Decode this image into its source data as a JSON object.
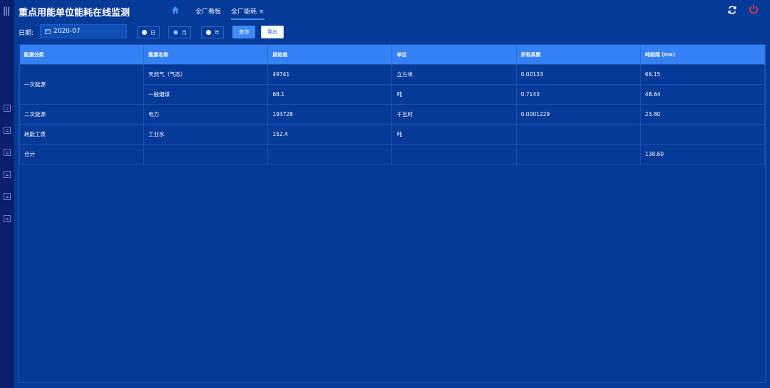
{
  "header": {
    "title": "重点用能单位能耗在线监测",
    "tabs": [
      {
        "label": "全厂看板"
      },
      {
        "label": "全厂能耗",
        "close": "×"
      }
    ]
  },
  "toolbar": {
    "date_label": "日期:",
    "date_value": "2020-07",
    "radios": [
      "日",
      "月",
      "年"
    ],
    "selected_radio": "月",
    "query_label": "查询",
    "export_label": "导出"
  },
  "table": {
    "columns": [
      "能源分类",
      "能源名称",
      "原始值",
      "单位",
      "折标系数",
      "吨标煤 (tce)"
    ],
    "rows": [
      {
        "category": "一次能源",
        "name": "天然气（气态）",
        "raw": "49741",
        "unit": "立方米",
        "factor": "0.00133",
        "tce": "66.15"
      },
      {
        "category": "",
        "name": "一般烟煤",
        "raw": "68.1",
        "unit": "吨",
        "factor": "0.7143",
        "tce": "48.64"
      },
      {
        "category": "二次能源",
        "name": "电力",
        "raw": "193728",
        "unit": "千瓦时",
        "factor": "0.0001229",
        "tce": "23.80"
      },
      {
        "category": "耗能工质",
        "name": "工业水",
        "raw": "152.4",
        "unit": "吨",
        "factor": "",
        "tce": ""
      },
      {
        "category": "合计",
        "name": "",
        "raw": "",
        "unit": "",
        "factor": "",
        "tce": "138.60"
      }
    ]
  },
  "colors": {
    "background": "#063a98",
    "header_row": "#3480f5",
    "power_icon": "#ff3b3b"
  },
  "icons": [
    "menu-icon",
    "home-icon",
    "refresh-icon",
    "power-icon",
    "calendar-icon"
  ]
}
